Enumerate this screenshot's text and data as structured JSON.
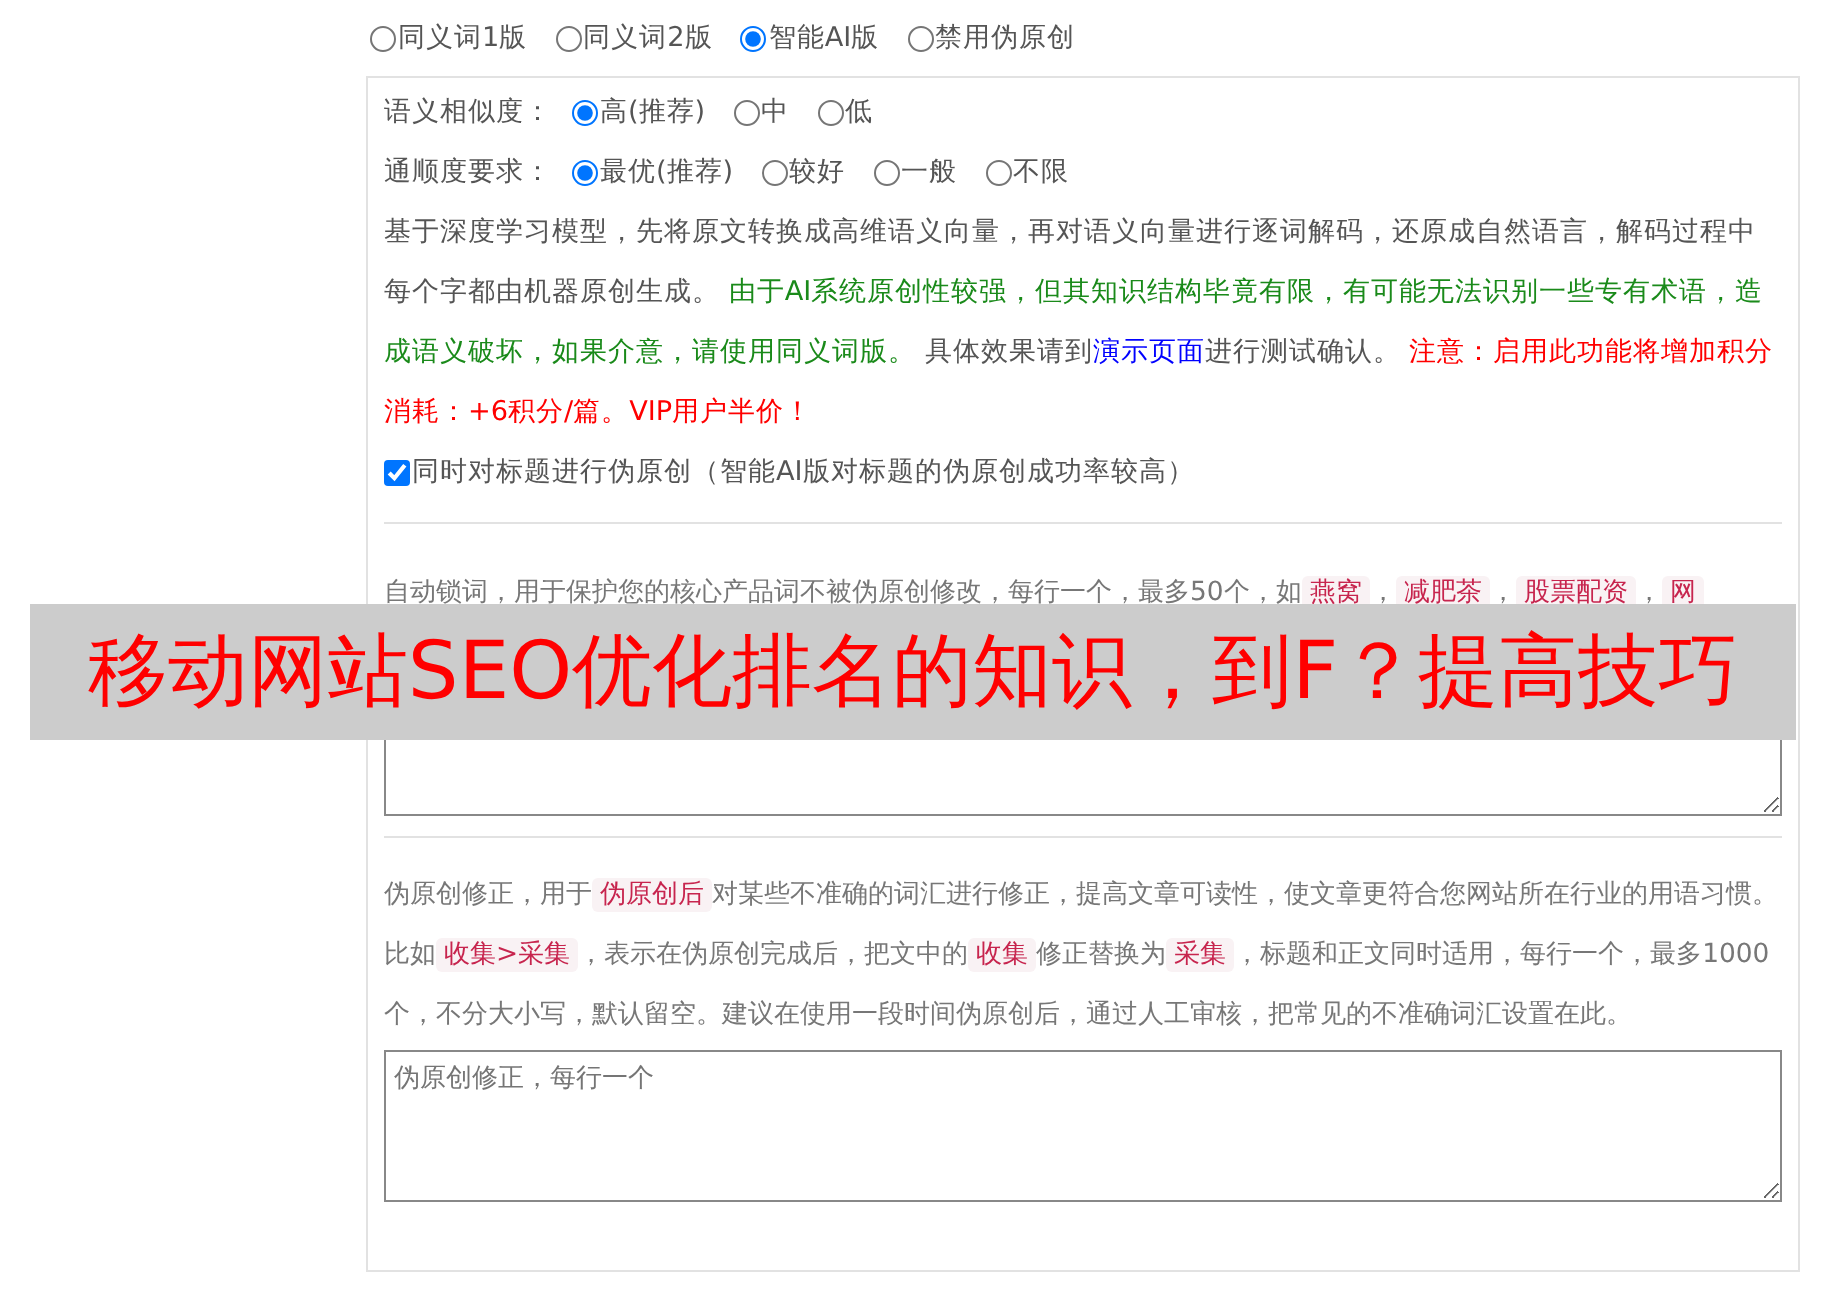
{
  "version_options": [
    {
      "label": "同义词1版",
      "selected": false
    },
    {
      "label": "同义词2版",
      "selected": false
    },
    {
      "label": "智能AI版",
      "selected": true
    },
    {
      "label": "禁用伪原创",
      "selected": false
    }
  ],
  "similarity": {
    "label": "语义相似度：",
    "options": [
      {
        "label": "高(推荐)",
        "selected": true
      },
      {
        "label": "中",
        "selected": false
      },
      {
        "label": "低",
        "selected": false
      }
    ]
  },
  "fluency": {
    "label": "通顺度要求：",
    "options": [
      {
        "label": "最优(推荐)",
        "selected": true
      },
      {
        "label": "较好",
        "selected": false
      },
      {
        "label": "一般",
        "selected": false
      },
      {
        "label": "不限",
        "selected": false
      }
    ]
  },
  "ai_description": [
    {
      "kind": "plain",
      "text": "基于深度学习模型，先将原文转换成高维语义向量，再对语义向量进行逐词解码，还原成自然语言，解码过程中每个字都由机器原创生成。 "
    },
    {
      "kind": "green",
      "text": "由于AI系统原创性较强，但其知识结构毕竟有限，有可能无法识别一些专有术语，造成语义破坏，如果介意，请使用同义词版。"
    },
    {
      "kind": "plain",
      "text": " 具体效果请到"
    },
    {
      "kind": "link",
      "text": "演示页面"
    },
    {
      "kind": "plain",
      "text": "进行测试确认。 "
    },
    {
      "kind": "red",
      "text": "注意：启用此功能将增加积分消耗：+6积分/篇。VIP用户半价！"
    }
  ],
  "title_option": {
    "label": "同时对标题进行伪原创（智能AI版对标题的伪原创成功率较高）",
    "checked": true
  },
  "lock_words": {
    "segments": [
      {
        "kind": "text",
        "text": "自动锁词，用于保护您的核心产品词不被伪原创修改，每行一个，最多50个，如"
      },
      {
        "kind": "tag",
        "text": "燕窝"
      },
      {
        "kind": "text",
        "text": "，"
      },
      {
        "kind": "tag",
        "text": "减肥茶"
      },
      {
        "kind": "text",
        "text": "，"
      },
      {
        "kind": "tag",
        "text": "股票配资"
      },
      {
        "kind": "text",
        "text": "，"
      },
      {
        "kind": "tag",
        "text": "网"
      }
    ]
  },
  "correction": {
    "segments": [
      {
        "kind": "text",
        "text": "伪原创修正，用于"
      },
      {
        "kind": "tag",
        "text": "伪原创后"
      },
      {
        "kind": "text",
        "text": "对某些不准确的词汇进行修正，提高文章可读性，使文章更符合您网站所在行业的用语习惯。比如"
      },
      {
        "kind": "tag",
        "text": "收集>采集"
      },
      {
        "kind": "text",
        "text": "，表示在伪原创完成后，把文中的"
      },
      {
        "kind": "tag",
        "text": "收集"
      },
      {
        "kind": "text",
        "text": "修正替换为"
      },
      {
        "kind": "tag",
        "text": "采集"
      },
      {
        "kind": "text",
        "text": "，标题和正文同时适用，每行一个，最多1000个，不分大小写，默认留空。建议在使用一段时间伪原创后，通过人工审核，把常见的不准确词汇设置在此。"
      }
    ],
    "placeholder": "伪原创修正，每行一个"
  },
  "banner": {
    "text": "移动网站SEO优化排名的知识，到F？提高技巧"
  }
}
